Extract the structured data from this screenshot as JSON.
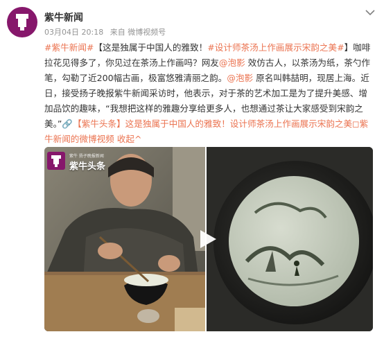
{
  "post": {
    "author": "紫牛新闻",
    "meta": {
      "date": "03月04日 20:18",
      "source": "来自 微博视频号"
    },
    "content": {
      "t1_hashtag": "#紫牛新闻#",
      "t2_text": "【这是独属于中国人的雅致！",
      "t3_hashtag": "#设计师茶汤上作画展示宋韵之美#",
      "t4_text": "】咖啡拉花见得多了，你见过在茶汤上作画吗？网友",
      "t5_mention": "@泡影",
      "t6_text": " 效仿古人，以茶汤为纸，茶勺作笔，勾勒了近200幅古画，极富悠雅清丽之韵。",
      "t7_mention": "@泡影",
      "t8_text": " 原名叫韩喆明，现居上海。近日，接受扬子晚报紫牛新闻采访时，他表示，对于茶的艺术加工是为了提升美感、增加品饮的趣味，“我想把这样的雅趣分享给更多人，也想通过茶让大家感受到宋韵之美。”",
      "t9_link": "🔗【紫牛头条】这是独属于中国人的雅致！设计师茶汤上作画展示宋韵之美",
      "t10_link": "◻紫牛新闻的微博视频",
      "t11_collapse": "收起^"
    },
    "media": {
      "brand_small": "紫牛 扬子晚报新闻",
      "brand_name": "紫牛头条"
    }
  }
}
